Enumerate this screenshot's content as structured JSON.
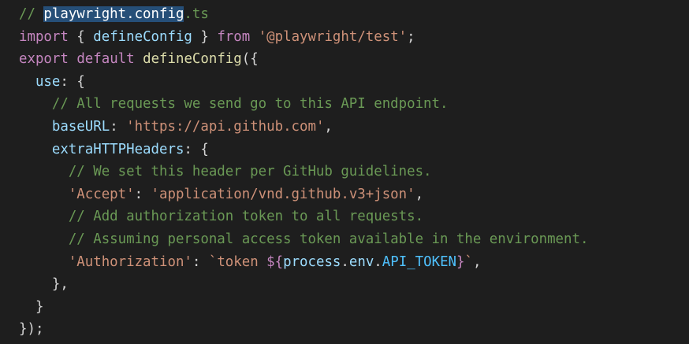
{
  "editor": {
    "lines": [
      [
        {
          "t": "// ",
          "c": "cm"
        },
        {
          "t": "playwright.config",
          "c": "sel"
        },
        {
          "t": ".ts",
          "c": "cm"
        }
      ],
      [
        {
          "t": "import",
          "c": "kw"
        },
        {
          "t": " { ",
          "c": "pn"
        },
        {
          "t": "defineConfig",
          "c": "vr"
        },
        {
          "t": " } ",
          "c": "pn"
        },
        {
          "t": "from",
          "c": "kw"
        },
        {
          "t": " ",
          "c": "pn"
        },
        {
          "t": "'@playwright/test'",
          "c": "st"
        },
        {
          "t": ";",
          "c": "pn"
        }
      ],
      [
        {
          "t": "export",
          "c": "kw"
        },
        {
          "t": " ",
          "c": "pn"
        },
        {
          "t": "default",
          "c": "kw"
        },
        {
          "t": " ",
          "c": "pn"
        },
        {
          "t": "defineConfig",
          "c": "fn"
        },
        {
          "t": "({",
          "c": "pn"
        }
      ],
      [
        {
          "t": "  ",
          "c": "pn"
        },
        {
          "t": "use",
          "c": "pr"
        },
        {
          "t": ": {",
          "c": "pn"
        }
      ],
      [
        {
          "t": "    ",
          "c": "pn"
        },
        {
          "t": "// All requests we send go to this API endpoint.",
          "c": "cm"
        }
      ],
      [
        {
          "t": "    ",
          "c": "pn"
        },
        {
          "t": "baseURL",
          "c": "pr"
        },
        {
          "t": ": ",
          "c": "pn"
        },
        {
          "t": "'https://api.github.com'",
          "c": "st"
        },
        {
          "t": ",",
          "c": "pn"
        }
      ],
      [
        {
          "t": "    ",
          "c": "pn"
        },
        {
          "t": "extraHTTPHeaders",
          "c": "pr"
        },
        {
          "t": ": {",
          "c": "pn"
        }
      ],
      [
        {
          "t": "      ",
          "c": "pn"
        },
        {
          "t": "// We set this header per GitHub guidelines.",
          "c": "cm"
        }
      ],
      [
        {
          "t": "      ",
          "c": "pn"
        },
        {
          "t": "'Accept'",
          "c": "st"
        },
        {
          "t": ": ",
          "c": "pn"
        },
        {
          "t": "'application/vnd.github.v3+json'",
          "c": "st"
        },
        {
          "t": ",",
          "c": "pn"
        }
      ],
      [
        {
          "t": "      ",
          "c": "pn"
        },
        {
          "t": "// Add authorization token to all requests.",
          "c": "cm"
        }
      ],
      [
        {
          "t": "      ",
          "c": "pn"
        },
        {
          "t": "// Assuming personal access token available in the environment.",
          "c": "cm"
        }
      ],
      [
        {
          "t": "      ",
          "c": "pn"
        },
        {
          "t": "'Authorization'",
          "c": "st"
        },
        {
          "t": ": ",
          "c": "pn"
        },
        {
          "t": "`token ",
          "c": "st"
        },
        {
          "t": "${",
          "c": "kw"
        },
        {
          "t": "process",
          "c": "vr"
        },
        {
          "t": ".",
          "c": "pn"
        },
        {
          "t": "env",
          "c": "vr"
        },
        {
          "t": ".",
          "c": "pn"
        },
        {
          "t": "API_TOKEN",
          "c": "cn"
        },
        {
          "t": "}",
          "c": "kw"
        },
        {
          "t": "`",
          "c": "st"
        },
        {
          "t": ",",
          "c": "pn"
        }
      ],
      [
        {
          "t": "    },",
          "c": "pn"
        }
      ],
      [
        {
          "t": "  }",
          "c": "pn"
        }
      ],
      [
        {
          "t": "});",
          "c": "pn"
        }
      ]
    ]
  },
  "colors": {
    "background": "#1e1e1e",
    "comment": "#6a9955",
    "keyword": "#c586c0",
    "string": "#ce9178",
    "function": "#dcdcaa",
    "property": "#9cdcfe",
    "constant": "#4fc1ff",
    "selection": "#264f78"
  }
}
